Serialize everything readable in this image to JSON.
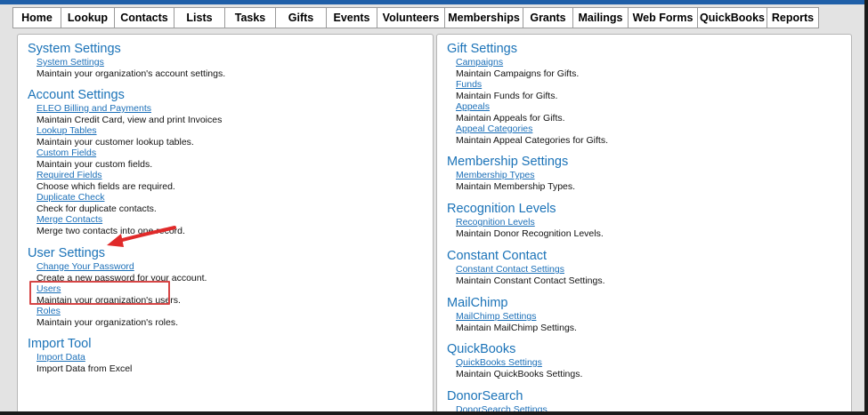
{
  "nav": {
    "items": [
      {
        "label": "Home",
        "w": 55
      },
      {
        "label": "Lookup",
        "w": 60
      },
      {
        "label": "Contacts",
        "w": 67
      },
      {
        "label": "Lists",
        "w": 57
      },
      {
        "label": "Tasks",
        "w": 57
      },
      {
        "label": "Gifts",
        "w": 57
      },
      {
        "label": "Events",
        "w": 57
      },
      {
        "label": "Volunteers",
        "w": 76
      },
      {
        "label": "Memberships",
        "w": 88
      },
      {
        "label": "Grants",
        "w": 56
      },
      {
        "label": "Mailings",
        "w": 62
      },
      {
        "label": "Web Forms",
        "w": 78
      },
      {
        "label": "QuickBooks",
        "w": 78
      },
      {
        "label": "Reports",
        "w": 58
      }
    ]
  },
  "left": {
    "sections": [
      {
        "title": "System Settings",
        "entries": [
          {
            "link": "System Settings",
            "desc": "Maintain your organization's account settings."
          }
        ]
      },
      {
        "title": "Account Settings",
        "entries": [
          {
            "link": "ELEO Billing and Payments",
            "desc": "Maintain Credit Card, view and print Invoices"
          },
          {
            "link": "Lookup Tables",
            "desc": "Maintain your customer lookup tables."
          },
          {
            "link": "Custom Fields",
            "desc": "Maintain your custom fields."
          },
          {
            "link": "Required Fields",
            "desc": "Choose which fields are required."
          },
          {
            "link": "Duplicate Check",
            "desc": "Check for duplicate contacts."
          },
          {
            "link": "Merge Contacts",
            "desc": "Merge two contacts into one record."
          }
        ]
      },
      {
        "title": "User Settings",
        "entries": [
          {
            "link": "Change Your Password",
            "desc": "Create a new password for your account."
          },
          {
            "link": "Users",
            "desc": "Maintain your organization's users."
          },
          {
            "link": "Roles",
            "desc": "Maintain your organization's roles."
          }
        ]
      },
      {
        "title": "Import Tool",
        "entries": [
          {
            "link": "Import Data",
            "desc": "Import Data from Excel"
          }
        ]
      }
    ]
  },
  "right": {
    "sections": [
      {
        "title": "Gift Settings",
        "entries": [
          {
            "link": "Campaigns",
            "desc": "Maintain Campaigns for Gifts."
          },
          {
            "link": "Funds",
            "desc": "Maintain Funds for Gifts."
          },
          {
            "link": "Appeals",
            "desc": "Maintain Appeals for Gifts."
          },
          {
            "link": "Appeal Categories",
            "desc": "Maintain Appeal Categories for Gifts."
          }
        ]
      },
      {
        "title": "Membership Settings",
        "entries": [
          {
            "link": "Membership Types",
            "desc": "Maintain Membership Types."
          }
        ]
      },
      {
        "title": "Recognition Levels",
        "entries": [
          {
            "link": "Recognition Levels",
            "desc": "Maintain Donor Recognition Levels."
          }
        ]
      },
      {
        "title": "Constant Contact",
        "entries": [
          {
            "link": "Constant Contact Settings",
            "desc": "Maintain Constant Contact Settings."
          }
        ]
      },
      {
        "title": "MailChimp",
        "entries": [
          {
            "link": "MailChimp Settings",
            "desc": "Maintain MailChimp Settings."
          }
        ]
      },
      {
        "title": "QuickBooks",
        "entries": [
          {
            "link": "QuickBooks Settings",
            "desc": "Maintain QuickBooks Settings."
          }
        ]
      },
      {
        "title": "DonorSearch",
        "entries": [
          {
            "link": "DonorSearch Settings",
            "desc": ""
          }
        ]
      }
    ]
  },
  "annotation": {
    "box_color": "#d64545",
    "arrow_color": "#e02a2a"
  }
}
